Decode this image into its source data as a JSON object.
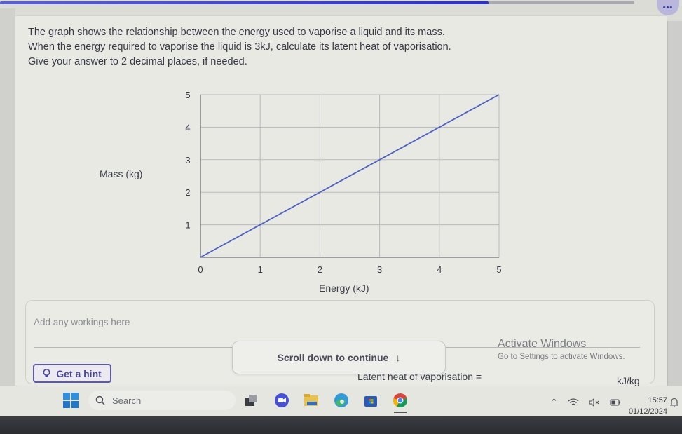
{
  "progress": {
    "fraction": 0.77,
    "fill_color": "#2a2fd0"
  },
  "more_button": {
    "label": "•••"
  },
  "question": {
    "lines": [
      "The graph shows the relationship between the energy used to vaporise a liquid and its mass.",
      "When the energy required to vaporise the liquid is 3kJ, calculate its latent heat of vaporisation.",
      "Give your answer to 2 decimal places, if needed."
    ]
  },
  "chart_data": {
    "type": "line",
    "title": "",
    "xlabel": "Energy (kJ)",
    "ylabel": "Mass (kg)",
    "xlim": [
      0,
      5
    ],
    "ylim": [
      0,
      5
    ],
    "x_ticks": [
      "0",
      "1",
      "2",
      "3",
      "4",
      "5"
    ],
    "y_ticks": [
      "1",
      "2",
      "3",
      "4",
      "5"
    ],
    "grid": true,
    "series": [
      {
        "name": "mass vs energy",
        "color": "#4a62c8",
        "x": [
          0,
          1,
          2,
          3,
          4,
          5
        ],
        "y": [
          0,
          1,
          2,
          3,
          4,
          5
        ]
      }
    ]
  },
  "workings": {
    "placeholder": "Add any workings here"
  },
  "hint_button": {
    "label": "Get a hint"
  },
  "scroll_pill": {
    "label": "Scroll down to continue",
    "arrow": "↓"
  },
  "answer": {
    "label": "Latent heat of vaporisation =",
    "unit": "kJ/kg"
  },
  "watermark": {
    "title": "Activate Windows",
    "subtitle": "Go to Settings to activate Windows."
  },
  "taskbar": {
    "search_placeholder": "Search",
    "apps": [
      "task-view",
      "meet",
      "file-explorer",
      "edge",
      "store",
      "chrome"
    ],
    "time": "15:57",
    "date": "01/12/2024"
  }
}
